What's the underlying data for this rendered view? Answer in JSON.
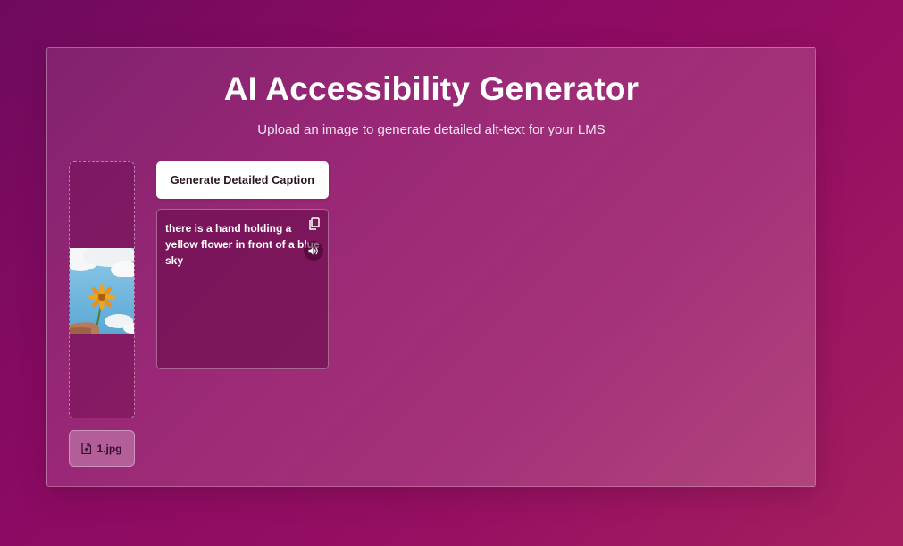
{
  "header": {
    "title": "AI Accessibility Generator",
    "subtitle": "Upload an image to generate detailed alt-text for your LMS"
  },
  "upload": {
    "file_name": "1.jpg",
    "preview_icon": "flower-photo"
  },
  "actions": {
    "generate_label": "Generate Detailed Caption"
  },
  "caption": {
    "text": "there is a hand holding a yellow flower in front of a blue sky",
    "copy_icon": "copy-icon",
    "speak_icon": "speaker-icon"
  },
  "colors": {
    "background_start": "#6e0a5e",
    "background_end": "#a51f60",
    "button_bg": "#ffffff",
    "text": "#ffffff"
  }
}
